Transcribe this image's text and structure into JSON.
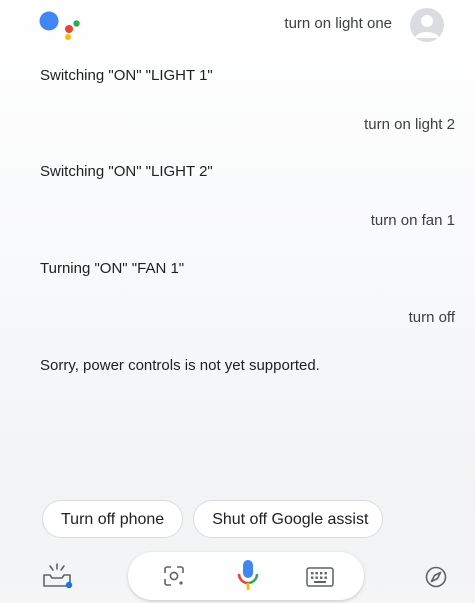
{
  "conversation": {
    "q1": "turn on light one",
    "a1": "Switching \"ON\" \"LIGHT 1\"",
    "q2": "turn on light 2",
    "a2": "Switching \"ON\" \"LIGHT 2\"",
    "q3": "turn on fan 1",
    "a3": "Turning \"ON\" \"FAN 1\"",
    "q4": "turn off",
    "a4": "Sorry, power controls is not yet supported."
  },
  "suggestions": [
    {
      "label": "Turn off phone"
    },
    {
      "label": "Shut off Google assist"
    }
  ],
  "icons": {
    "logo": "google-assistant-logo",
    "avatar": "user-avatar-icon",
    "updates": "updates-tray-icon",
    "lens": "lens-icon",
    "mic": "microphone-icon",
    "keyboard": "keyboard-icon",
    "explore": "explore-compass-icon"
  },
  "colors": {
    "blue": "#4285F4",
    "red": "#EA4335",
    "yellow": "#FBBC05",
    "green": "#34A853"
  }
}
